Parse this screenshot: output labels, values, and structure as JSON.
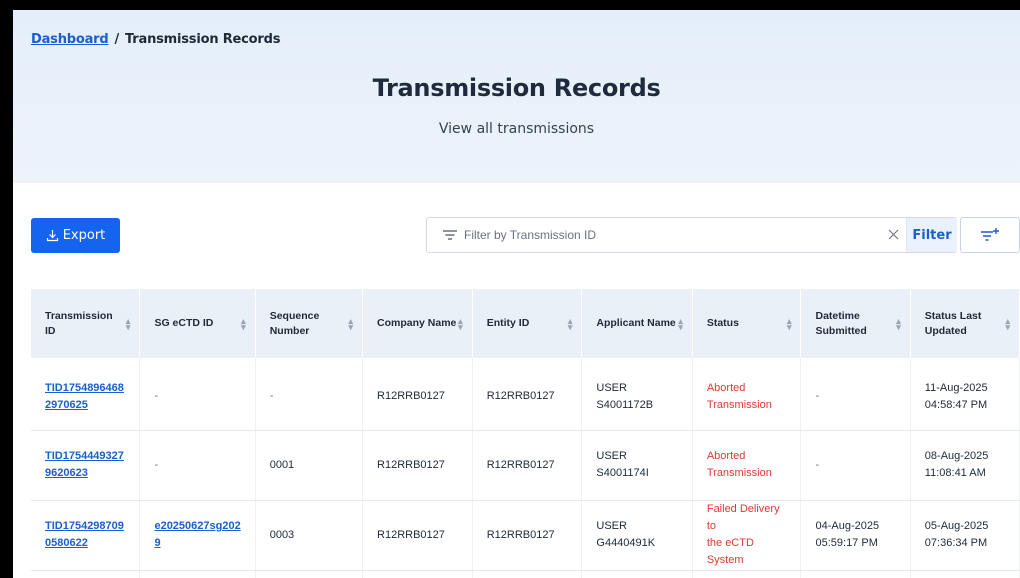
{
  "breadcrumb": {
    "home": "Dashboard",
    "separator": "/",
    "current": "Transmission Records"
  },
  "header": {
    "title": "Transmission Records",
    "subtitle": "View all transmissions"
  },
  "toolbar": {
    "export_label": "Export",
    "filter_placeholder": "Filter by Transmission ID",
    "filter_value": "",
    "filter_button": "Filter",
    "clear_icon": "close-icon",
    "filter_icon": "filter-lines-icon",
    "advanced_filter_icon": "filter-add-icon"
  },
  "colors": {
    "accent": "#1464f0",
    "link": "#1a5fcf",
    "error": "#dc3b2f",
    "header_bg": "#e4eefa",
    "table_header_bg": "#eaf0f8"
  },
  "table": {
    "columns": [
      {
        "label": "Transmission ID",
        "lines": [
          "Transmission ID"
        ]
      },
      {
        "label": "SG eCTD ID",
        "lines": [
          "SG eCTD ID"
        ]
      },
      {
        "label": "Sequence Number",
        "lines": [
          "Sequence",
          "Number"
        ]
      },
      {
        "label": "Company Name",
        "lines": [
          "Company Name"
        ]
      },
      {
        "label": "Entity ID",
        "lines": [
          "Entity ID"
        ]
      },
      {
        "label": "Applicant Name",
        "lines": [
          "Applicant Name"
        ]
      },
      {
        "label": "Status",
        "lines": [
          "Status"
        ]
      },
      {
        "label": "Datetime Submitted",
        "lines": [
          "Datetime",
          "Submitted"
        ]
      },
      {
        "label": "Status Last Updated",
        "lines": [
          "Status Last",
          "Updated"
        ]
      }
    ],
    "rows": [
      {
        "transmission_id": [
          "TID1754896468",
          "2970625"
        ],
        "sg_ectd_id": [
          "-"
        ],
        "sequence_number": "-",
        "company_name": "R12RRB0127",
        "entity_id": "R12RRB0127",
        "applicant_name": "USER S4001172B",
        "status": [
          "Aborted",
          "Transmission"
        ],
        "datetime_submitted": [
          "-"
        ],
        "status_last_updated": [
          "11-Aug-2025",
          "04:58:47 PM"
        ]
      },
      {
        "transmission_id": [
          "TID1754449327",
          "9620623"
        ],
        "sg_ectd_id": [
          "-"
        ],
        "sequence_number": "0001",
        "company_name": "R12RRB0127",
        "entity_id": "R12RRB0127",
        "applicant_name": "USER S4001174I",
        "status": [
          "Aborted",
          "Transmission"
        ],
        "datetime_submitted": [
          "-"
        ],
        "status_last_updated": [
          "08-Aug-2025",
          "11:08:41 AM"
        ]
      },
      {
        "transmission_id": [
          "TID1754298709",
          "0580622"
        ],
        "sg_ectd_id": [
          "e20250627sg202",
          "9"
        ],
        "sequence_number": "0003",
        "company_name": "R12RRB0127",
        "entity_id": "R12RRB0127",
        "applicant_name": "USER G4440491K",
        "status": [
          "Failed Delivery to",
          "the eCTD System"
        ],
        "datetime_submitted": [
          "04-Aug-2025",
          "05:59:17 PM"
        ],
        "status_last_updated": [
          "05-Aug-2025",
          "07:36:34 PM"
        ]
      }
    ]
  }
}
